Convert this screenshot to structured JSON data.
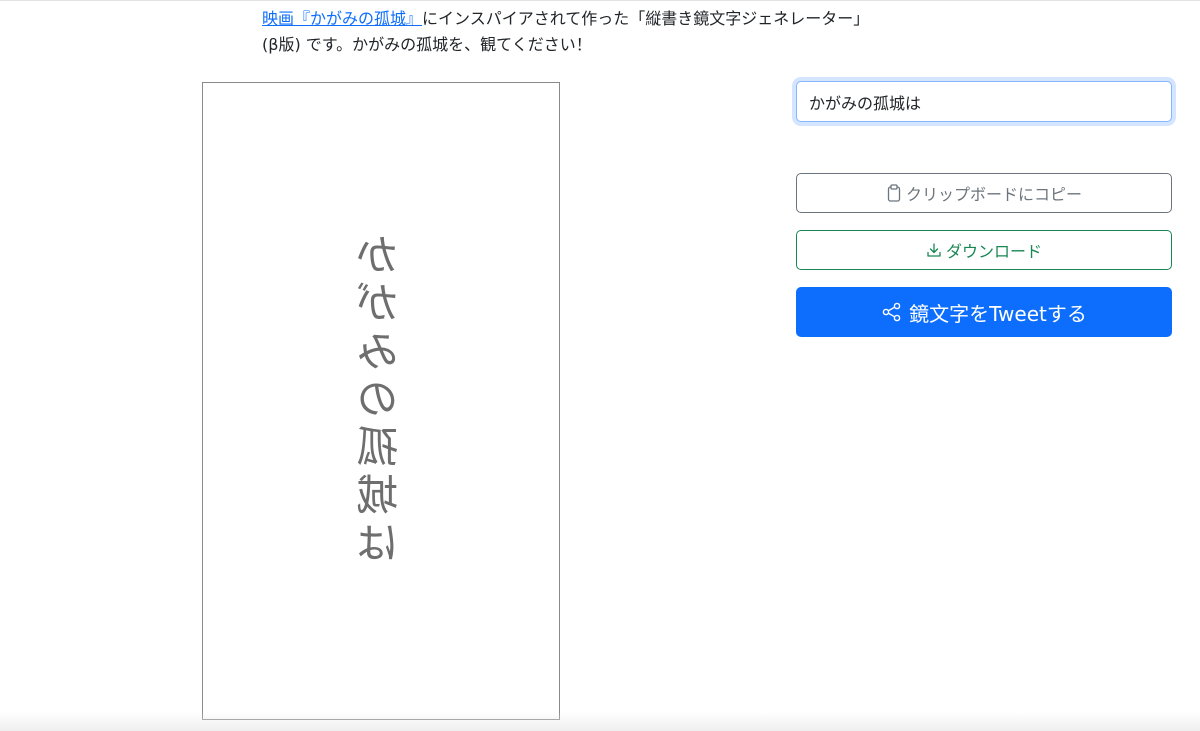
{
  "intro": {
    "link_text": "映画『かがみの孤城』",
    "text": "にインスパイアされて作った「縦書き鏡文字ジェネレーター」(β版) です。かがみの孤城を、観てください！"
  },
  "preview": {
    "mirrored_text": "かがみの孤城は"
  },
  "input": {
    "value": "かがみの孤城は"
  },
  "buttons": {
    "copy_label": "クリップボードにコピー",
    "copy_icon": "clipboard-icon",
    "download_label": "ダウンロード",
    "download_icon": "download-icon",
    "tweet_label": "鏡文字をTweetする",
    "tweet_icon": "share-icon"
  },
  "colors": {
    "link": "#0d6efd",
    "copy": "#6c757d",
    "download": "#198754",
    "tweet_bg": "#0d6efd",
    "mirror_text": "#6e6e6e"
  }
}
